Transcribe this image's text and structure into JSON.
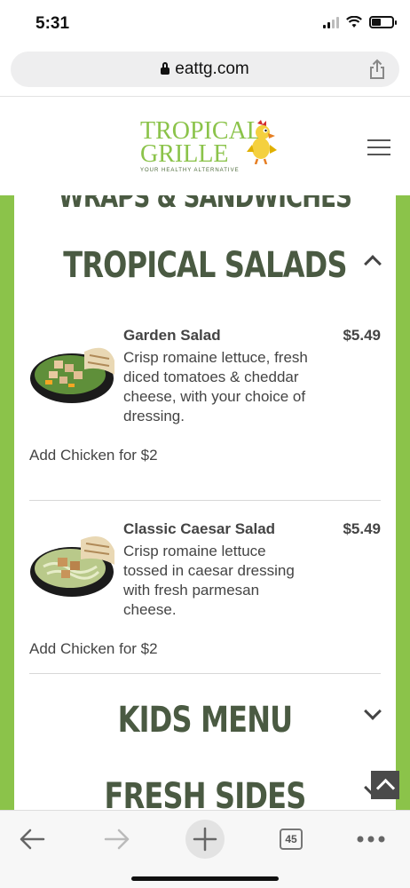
{
  "status": {
    "time": "5:31"
  },
  "browser": {
    "url": "eattg.com",
    "tab_count": "45"
  },
  "site": {
    "logo_line1": "TROPICAL",
    "logo_line2": "GRILLE",
    "logo_tagline": "YOUR HEALTHY ALTERNATIVE"
  },
  "menu": {
    "previous_section": "WRAPS & SANDWICHES",
    "current_section": "TROPICAL SALADS",
    "items": [
      {
        "name": "Garden Salad",
        "price": "$5.49",
        "description": "Crisp romaine lettuce, fresh diced tomatoes & cheddar cheese, with your choice of dressing.",
        "addon": "Add Chicken for $2"
      },
      {
        "name": "Classic Caesar Salad",
        "price": "$5.49",
        "description": "Crisp romaine lettuce tossed in caesar dressing with fresh parmesan cheese.",
        "addon": "Add Chicken for $2"
      }
    ],
    "next_sections": [
      "KIDS MENU",
      "FRESH SIDES"
    ]
  },
  "colors": {
    "brand_green": "#8bc34a",
    "heading": "#4a5a42"
  },
  "icons": [
    "lock-icon",
    "share-icon",
    "parrot-logo-icon",
    "hamburger-menu-icon",
    "chevron-up-icon",
    "chevron-down-icon",
    "scroll-to-top-icon",
    "back-icon",
    "forward-icon",
    "new-tab-icon",
    "tabs-icon",
    "more-icon"
  ]
}
